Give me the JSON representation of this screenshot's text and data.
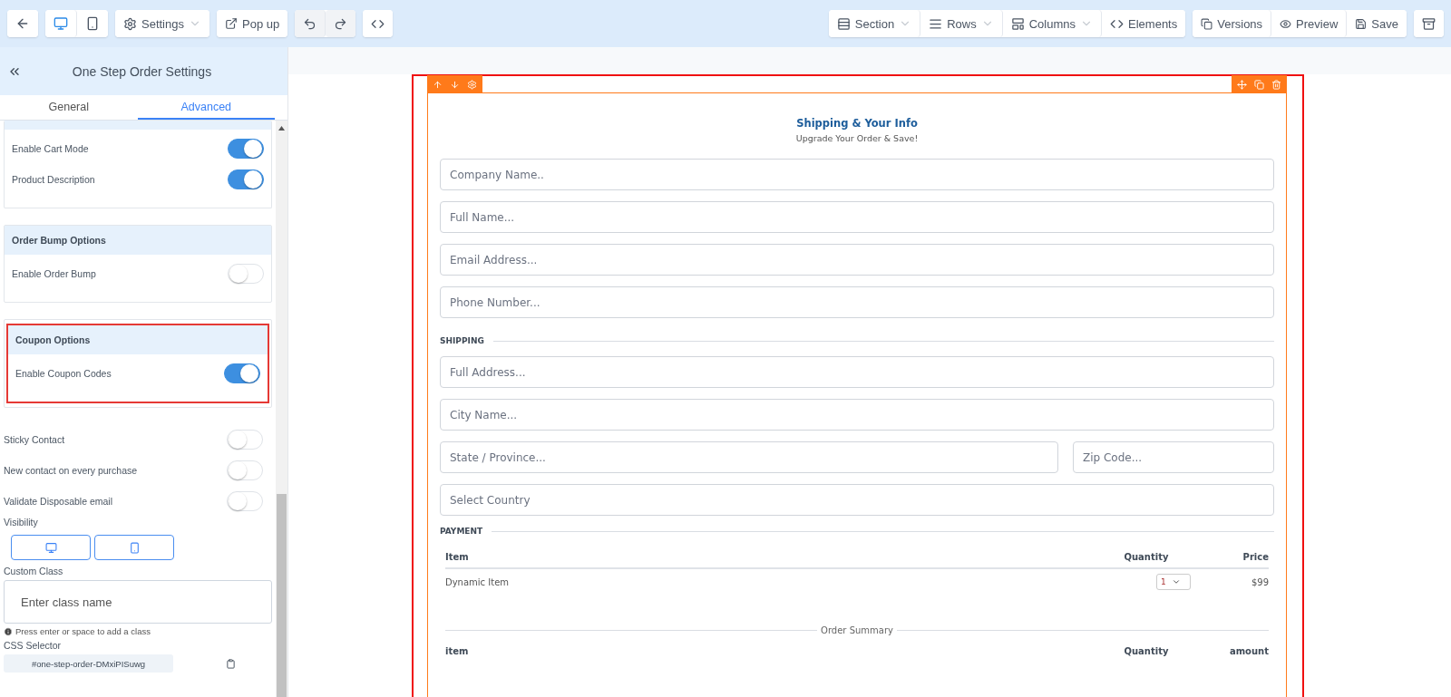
{
  "toolbar": {
    "devices": [
      {
        "kind": "desktop",
        "selected": true
      },
      {
        "kind": "mobile",
        "selected": false
      }
    ],
    "settings_label": "Settings",
    "popup_label": "Pop up",
    "right_menus": [
      {
        "kind": "section",
        "label": "Section",
        "dropdown": true
      },
      {
        "kind": "rows",
        "label": "Rows",
        "dropdown": true
      },
      {
        "kind": "columns",
        "label": "Columns",
        "dropdown": true
      },
      {
        "kind": "elements",
        "label": "Elements",
        "dropdown": false
      }
    ],
    "actions": [
      {
        "kind": "versions",
        "label": "Versions"
      },
      {
        "kind": "preview",
        "label": "Preview"
      },
      {
        "kind": "save",
        "label": "Save"
      }
    ]
  },
  "sidebar": {
    "title": "One Step Order Settings",
    "tabs": [
      {
        "label": "General",
        "selected": false
      },
      {
        "label": "Advanced",
        "selected": true
      }
    ],
    "cards": [
      {
        "highlighted": false,
        "toggles": [
          {
            "label": "Enable Cart Mode",
            "on": true
          },
          {
            "label": "Product Description",
            "on": true
          }
        ]
      },
      {
        "title": "Order Bump Options",
        "highlighted": false,
        "toggles": [
          {
            "label": "Enable Order Bump",
            "on": false
          }
        ]
      },
      {
        "title": "Coupon Options",
        "highlighted": true,
        "toggles": [
          {
            "label": "Enable Coupon Codes",
            "on": true
          }
        ]
      }
    ],
    "toggles": [
      {
        "label": "Sticky Contact",
        "on": false
      },
      {
        "label": "New contact on every purchase",
        "on": false
      },
      {
        "label": "Validate Disposable email",
        "on": false
      }
    ],
    "visibility_label": "Visibility",
    "visibility": [
      {
        "kind": "desktop"
      },
      {
        "kind": "mobile"
      }
    ],
    "custom_class_label": "Custom Class",
    "custom_class_placeholder": "Enter class name",
    "hint": "Press enter or space to add a class",
    "css_selector_label": "CSS Selector",
    "css_selector": "#one-step-order-DMxiPISuwg"
  },
  "form": {
    "title": "Shipping & Your Info",
    "subtitle": "Upgrade Your Order & Save!",
    "contact_fields": [
      {
        "placeholder": "Company Name.."
      },
      {
        "placeholder": "Full Name..."
      },
      {
        "placeholder": "Email Address..."
      },
      {
        "placeholder": "Phone Number..."
      }
    ],
    "shipping_label": "SHIPPING",
    "shipping_rows": [
      {
        "fields": [
          {
            "placeholder": "Full Address..."
          }
        ]
      },
      {
        "fields": [
          {
            "placeholder": "City Name..."
          }
        ]
      },
      {
        "fields": [
          {
            "placeholder": "State / Province..."
          },
          {
            "placeholder": "Zip Code..."
          }
        ]
      },
      {
        "fields": [
          {
            "placeholder": "Select Country"
          }
        ]
      }
    ],
    "payment_label": "PAYMENT",
    "items_table": {
      "columns": [
        "Item",
        "Quantity",
        "Price"
      ],
      "rows": [
        {
          "item": "Dynamic Item",
          "quantity": "1",
          "price": "$99"
        }
      ]
    },
    "summary_label": "Order Summary",
    "summary_columns": [
      "item",
      "Quantity",
      "amount"
    ]
  }
}
